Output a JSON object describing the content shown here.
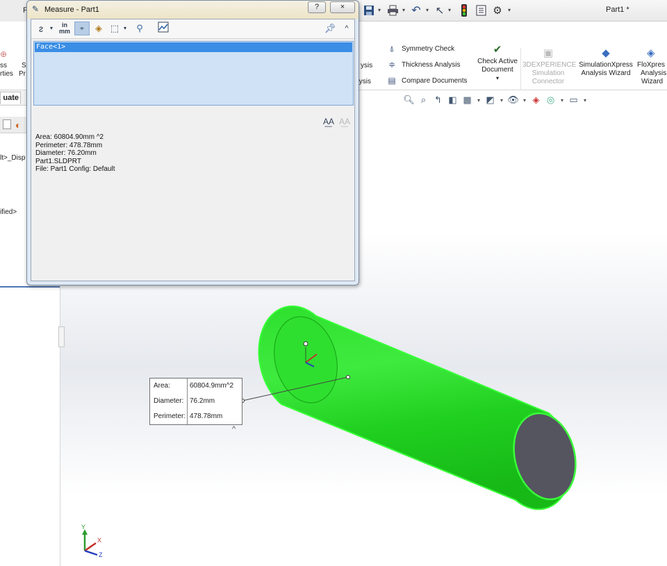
{
  "titlebar": {
    "doc_title": "Part1 *",
    "menu_left": "F"
  },
  "ribbon": {
    "left_labels": {
      "col1_a": "ss",
      "col1_b": "rties",
      "col2_a": "S",
      "col2_b": "Pr"
    },
    "mid_labels": {
      "a": "ysis",
      "b": "alysis"
    },
    "small_buttons": [
      {
        "label": "Symmetry Check",
        "icon": "symmetry-check-icon"
      },
      {
        "label": "Thickness Analysis",
        "icon": "thickness-analysis-icon"
      },
      {
        "label": "Compare Documents",
        "icon": "compare-documents-icon"
      }
    ],
    "check_active": {
      "line1": "Check Active",
      "line2": "Document"
    },
    "experience": {
      "line1": "3DEXPERIENCE",
      "line2": "Simulation",
      "line3": "Connector"
    },
    "simxpress": {
      "line1": "SimulationXpress",
      "line2": "Analysis Wizard"
    },
    "floxpress": {
      "line1": "FloXpres",
      "line2": "Analysis",
      "line3": "Wizard"
    }
  },
  "tabs": {
    "evaluate": "uate"
  },
  "tree": {
    "item1": "lt>_Disp",
    "item2": "ified>"
  },
  "measure": {
    "title": "Measure - Part1",
    "help_button": "?",
    "close_button": "×",
    "selection": "Face<1>",
    "results": [
      "Area: 60804.90mm ^2",
      "Perimeter: 478.78mm",
      "Diameter: 76.20mm",
      "Part1.SLDPRT",
      "File: Part1 Config: Default"
    ],
    "toolbar": {
      "units_top": "in",
      "units_bottom": "mm"
    }
  },
  "callout": {
    "rows": [
      {
        "key": "Area:",
        "value": "60804.9mm^2"
      },
      {
        "key": "Diameter:",
        "value": "76.2mm"
      },
      {
        "key": "Perimeter:",
        "value": "478.78mm"
      }
    ]
  },
  "triad": {
    "x": "X",
    "y": "Y",
    "z": "Z"
  },
  "colors": {
    "face_highlight": "#22cc22",
    "end_cap": "#555560",
    "selection_bg": "#3a8ee6"
  }
}
